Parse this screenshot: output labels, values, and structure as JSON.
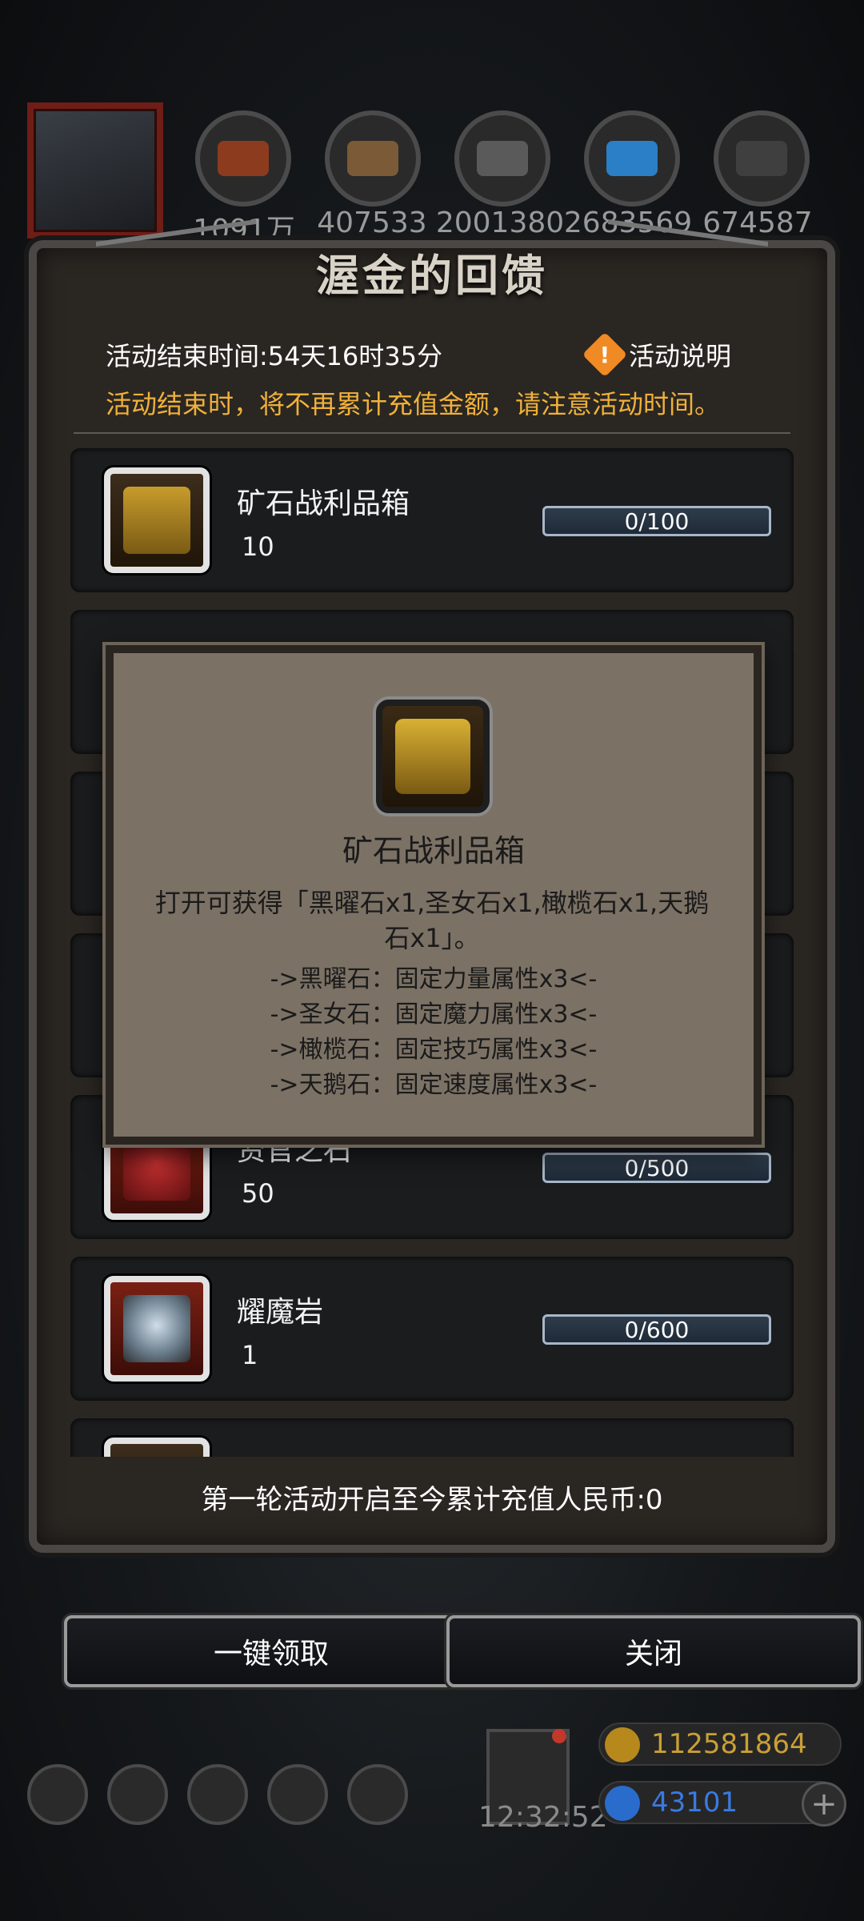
{
  "resources": [
    {
      "name": "copper",
      "count": "1091万"
    },
    {
      "name": "wood",
      "count": "407533"
    },
    {
      "name": "iron",
      "count": "2001380"
    },
    {
      "name": "crystal",
      "count": "2683569"
    },
    {
      "name": "steel",
      "count": "674587"
    }
  ],
  "panel": {
    "title": "渥金的回馈",
    "end_time_label": "活动结束时间:54天16时35分",
    "explain_label": "活动说明",
    "notice": "活动结束时，将不再累计充值金额，请注意活动时间。",
    "summary": "第一轮活动开启至今累计充值人民币:0"
  },
  "rewards": [
    {
      "name": "矿石战利品箱",
      "qty": "10",
      "progress": "0/100",
      "icon": "treasure-chest-icon"
    },
    {
      "name": "资官之石",
      "qty": "50",
      "progress": "0/500",
      "icon": "crimson-stone-icon"
    },
    {
      "name": "耀魔岩",
      "qty": "1",
      "progress": "0/600",
      "icon": "crystal-shard-icon"
    }
  ],
  "popup": {
    "title": "矿石战利品箱",
    "desc": "打开可获得「黑曜石x1,圣女石x1,橄榄石x1,天鹅石x1」。",
    "lines": [
      "->黑曜石：固定力量属性x3<-",
      "->圣女石：固定魔力属性x3<-",
      "->橄榄石：固定技巧属性x3<-",
      "->天鹅石：固定速度属性x3<-"
    ]
  },
  "buttons": {
    "claim_all": "一键领取",
    "close": "关闭"
  },
  "hud": {
    "time": "12:32:52",
    "gold": "112581864",
    "gems": "43101",
    "plus": "+"
  },
  "colors": {
    "notice_orange": "#f0b13a",
    "progress_border": "#a7b7c9",
    "popup_bg": "#7b7165",
    "gold_text": "#c9a037",
    "gem_text": "#3a7ae0"
  }
}
